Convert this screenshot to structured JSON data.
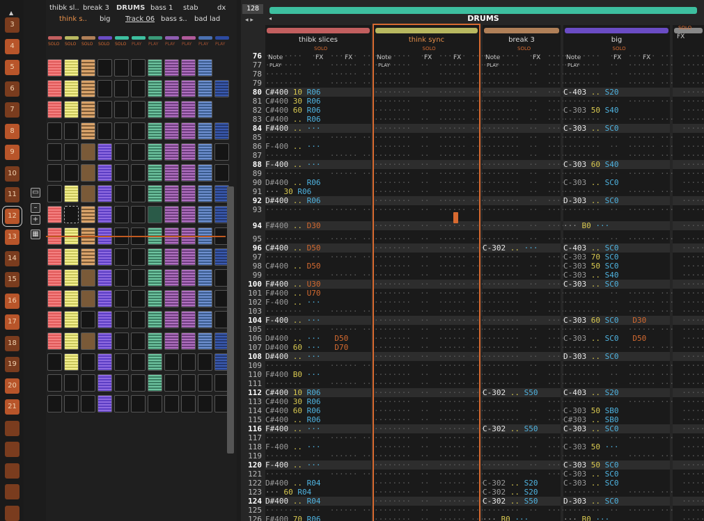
{
  "app": {
    "pattern_length": "128",
    "group_name": "DRUMS"
  },
  "sequence": {
    "numbers": [
      "3",
      "4",
      "5",
      "6",
      "7",
      "8",
      "9",
      "10",
      "11",
      "12",
      "13",
      "14",
      "15",
      "16",
      "17",
      "18",
      "19",
      "20",
      "21",
      "",
      "",
      "",
      "",
      ""
    ],
    "selected": "12"
  },
  "matrix": {
    "track_labels": [
      "thibk sl..",
      "break 3",
      "DRUMS",
      "bass 1",
      "stab",
      "dx",
      "think s..",
      "big",
      "Track 06",
      "bass s..",
      "bad lad"
    ],
    "solo_label": "SOLO",
    "play_label": "PLAY"
  },
  "tracks": [
    {
      "name": "thibk slices",
      "color": "#c25f5f",
      "solo": "SOLO",
      "cols": [
        "Note",
        "FX",
        "FX"
      ],
      "mode": "PLAY"
    },
    {
      "name": "think sync",
      "color": "#b8b860",
      "solo": "SOLO",
      "cols": [
        "Note",
        "FX",
        "FX"
      ],
      "mode": "PLAY"
    },
    {
      "name": "break 3",
      "color": "#b08058",
      "solo": "SOLO",
      "cols": [
        "Note",
        "FX"
      ],
      "mode": "PLAY"
    },
    {
      "name": "big",
      "color": "#6a4cc4",
      "solo": "SOLO",
      "cols": [
        "Note",
        "FX",
        "FX"
      ],
      "mode": "PLAY"
    },
    {
      "name": "",
      "color": "#888888",
      "solo": "SOLO",
      "cols": [
        "FX"
      ],
      "mode": ""
    }
  ],
  "rows": [
    "76",
    "77",
    "78",
    "79",
    "80",
    "81",
    "82",
    "83",
    "84",
    "85",
    "86",
    "87",
    "88",
    "89",
    "90",
    "91",
    "92",
    "93",
    "94",
    "95",
    "96",
    "97",
    "98",
    "99",
    "100",
    "101",
    "102",
    "103",
    "104",
    "105",
    "106",
    "107",
    "108",
    "109",
    "110",
    "111",
    "112",
    "113",
    "114",
    "115",
    "116",
    "117",
    "118",
    "119",
    "120",
    "121",
    "122",
    "123",
    "124",
    "125",
    "126"
  ],
  "cells": {
    "t1": {
      "80": [
        "C#400",
        "10",
        "R06",
        ""
      ],
      "81": [
        "C#400",
        "30",
        "R06",
        ""
      ],
      "82": [
        "C#400",
        "60",
        "R06",
        ""
      ],
      "83": [
        "C#400",
        "..",
        "R06",
        ""
      ],
      "84": [
        "F#400",
        "",
        "",
        ""
      ],
      "86": [
        "F-400",
        "",
        "",
        ""
      ],
      "88": [
        "F-400",
        "",
        "",
        ""
      ],
      "90": [
        "D#400",
        "..",
        "R06",
        ""
      ],
      "91": [
        "",
        "30",
        "R06",
        ""
      ],
      "92": [
        "D#400",
        "..",
        "R06",
        ""
      ],
      "94": [
        "F#400",
        "..",
        "D30",
        ""
      ],
      "96": [
        "C#400",
        "..",
        "D50",
        ""
      ],
      "98": [
        "C#400",
        "..",
        "D50",
        ""
      ],
      "100": [
        "F#400",
        "..",
        "U30",
        ""
      ],
      "101": [
        "F#400",
        "..",
        "U70",
        ""
      ],
      "102": [
        "F-400",
        "",
        "",
        ""
      ],
      "104": [
        "F-400",
        "",
        "",
        ""
      ],
      "106": [
        "D#400",
        "..",
        "",
        "D50"
      ],
      "107": [
        "D#400",
        "60",
        "",
        "D70"
      ],
      "108": [
        "D#400",
        "",
        "",
        ""
      ],
      "110": [
        "F#400",
        "B0",
        "",
        ""
      ],
      "112": [
        "C#400",
        "10",
        "R06",
        ""
      ],
      "113": [
        "C#400",
        "30",
        "R06",
        ""
      ],
      "114": [
        "C#400",
        "60",
        "R06",
        ""
      ],
      "115": [
        "C#400",
        "..",
        "R06",
        ""
      ],
      "116": [
        "F#400",
        "",
        "",
        ""
      ],
      "118": [
        "F-400",
        "",
        "",
        ""
      ],
      "120": [
        "F-400",
        "",
        "",
        ""
      ],
      "122": [
        "D#400",
        "..",
        "R04",
        ""
      ],
      "123": [
        "",
        "60",
        "R04",
        ""
      ],
      "124": [
        "D#400",
        "..",
        "R04",
        ""
      ],
      "126": [
        "F#400",
        "70",
        "R06",
        ""
      ]
    },
    "t3": {
      "96": [
        "C-302",
        "",
        ""
      ],
      "112": [
        "C-302",
        "..",
        "S50"
      ],
      "116": [
        "C-302",
        "..",
        "S50"
      ],
      "122": [
        "C-302",
        "..",
        "S20"
      ],
      "123": [
        "C-302",
        "..",
        "S20"
      ],
      "124": [
        "C-302",
        "..",
        "S50"
      ],
      "126": [
        "",
        "B0",
        ""
      ]
    },
    "t4": {
      "80": [
        "C-403",
        "..",
        "S20",
        ""
      ],
      "82": [
        "C-303",
        "50",
        "S40",
        ""
      ],
      "84": [
        "C-303",
        "..",
        "SC0",
        ""
      ],
      "88": [
        "C-303",
        "60",
        "S40",
        ""
      ],
      "90": [
        "C-303",
        "..",
        "SC0",
        ""
      ],
      "92": [
        "D-303",
        "..",
        "SC0",
        ""
      ],
      "94": [
        "",
        "B0",
        "",
        ""
      ],
      "96": [
        "C-403",
        "..",
        "SC0",
        ""
      ],
      "97": [
        "C-303",
        "70",
        "SC0",
        ""
      ],
      "98": [
        "C-303",
        "50",
        "SC0",
        ""
      ],
      "99": [
        "C-303",
        "..",
        "S40",
        ""
      ],
      "100": [
        "C-303",
        "..",
        "SC0",
        ""
      ],
      "104": [
        "C-303",
        "60",
        "SC0",
        "D30"
      ],
      "106": [
        "C-303",
        "..",
        "SC0",
        "D50"
      ],
      "108": [
        "D-303",
        "..",
        "SC0",
        ""
      ],
      "112": [
        "C-403",
        "..",
        "S20",
        ""
      ],
      "114": [
        "C-303",
        "50",
        "SB0",
        ""
      ],
      "115": [
        "C#303",
        "..",
        "SB0",
        ""
      ],
      "116": [
        "C-303",
        "..",
        "SC0",
        ""
      ],
      "118": [
        "C-303",
        "50",
        "",
        ""
      ],
      "120": [
        "C-303",
        "50",
        "SC0",
        ""
      ],
      "121": [
        "C-303",
        "..",
        "SC0",
        ""
      ],
      "122": [
        "C-303",
        "..",
        "SC0",
        ""
      ],
      "124": [
        "D-303",
        "..",
        "SC0",
        ""
      ],
      "126": [
        "",
        "B0",
        "",
        ""
      ]
    }
  }
}
